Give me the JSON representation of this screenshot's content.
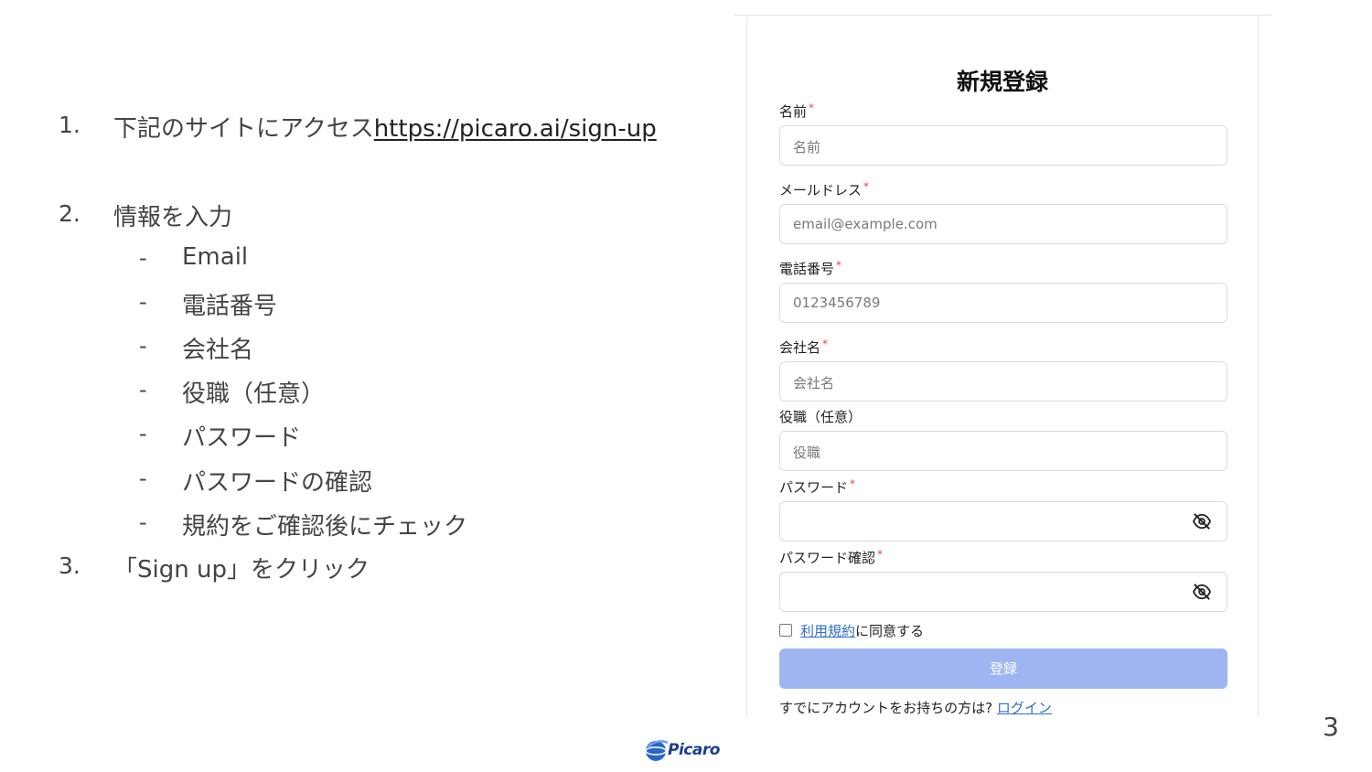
{
  "instructions": {
    "step1": {
      "num": "1.",
      "text": "下記のサイトにアクセス",
      "link": "https://picaro.ai/sign-up"
    },
    "step2": {
      "num": "2.",
      "text": "情報を入力",
      "items": [
        "Email",
        "電話番号",
        "会社名",
        "役職（任意）",
        "パスワード",
        "パスワードの確認",
        "規約をご確認後にチェック"
      ]
    },
    "step3": {
      "num": "3.",
      "text": "「Sign up」をクリック"
    },
    "dash": "-"
  },
  "form": {
    "title": "新規登録",
    "required_mark": "*",
    "fields": [
      {
        "label": "名前",
        "placeholder": "名前",
        "required": true
      },
      {
        "label": "メールドレス",
        "placeholder": "email@example.com",
        "required": true
      },
      {
        "label": "電話番号",
        "placeholder": "0123456789",
        "required": true
      },
      {
        "label": "会社名",
        "placeholder": "会社名",
        "required": true
      },
      {
        "label": "役職（任意）",
        "placeholder": "役職",
        "required": false
      },
      {
        "label": "パスワード",
        "placeholder": "",
        "required": true,
        "icon": "eye-off-icon"
      },
      {
        "label": "パスワード確認",
        "placeholder": "",
        "required": true,
        "icon": "eye-off-icon"
      }
    ],
    "agree_terms_link": "利用規約",
    "agree_suffix": "に同意する",
    "submit_label": "登録",
    "login_prompt": "すでにアカウントをお持ちの方は?",
    "login_link": "ログイン",
    "colors": {
      "submit": "#9eb5f2",
      "link": "#2f6fc9",
      "required": "#e04a3a"
    }
  },
  "footer": {
    "page_number": "3",
    "logo_text": "Picaro"
  }
}
